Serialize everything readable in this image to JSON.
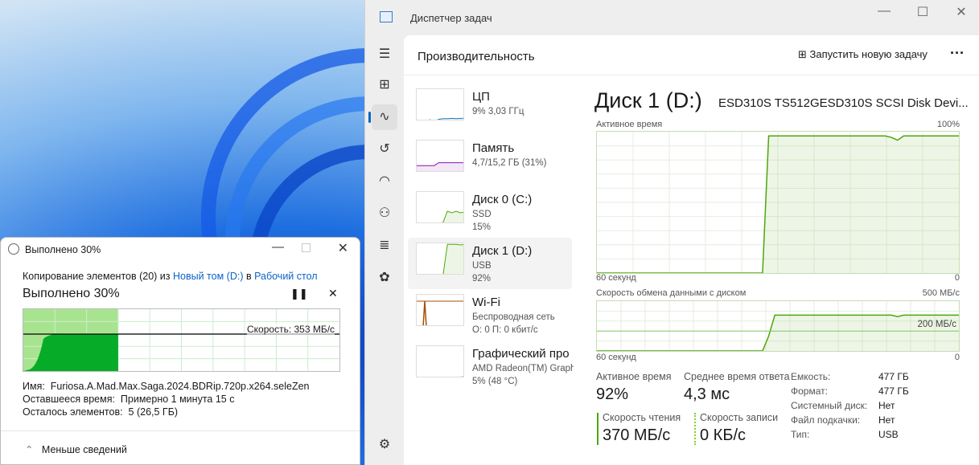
{
  "taskmanager": {
    "title": "Диспетчер задач",
    "header": "Производительность",
    "run_task": "Запустить новую задачу",
    "more": "···",
    "nav_icons": [
      "menu-icon",
      "processes-icon",
      "performance-icon",
      "app-history-icon",
      "startup-icon",
      "users-icon",
      "details-icon",
      "services-icon",
      "settings-icon"
    ],
    "devices": [
      {
        "name": "ЦП",
        "line1": "9% 3,03 ГГц",
        "line2": "",
        "color": "#1f7ac4"
      },
      {
        "name": "Память",
        "line1": "4,7/15,2 ГБ (31%)",
        "line2": "",
        "color": "#8b12ae"
      },
      {
        "name": "Диск 0 (C:)",
        "line1": "SSD",
        "line2": "15%",
        "color": "#4da60c"
      },
      {
        "name": "Диск 1 (D:)",
        "line1": "USB",
        "line2": "92%",
        "color": "#4da60c",
        "selected": true
      },
      {
        "name": "Wi-Fi",
        "line1": "Беспроводная сеть",
        "line2": "О: 0 П: 0 кбит/с",
        "color": "#a74f01"
      },
      {
        "name": "Графический про",
        "line1": "AMD Radeon(TM) Graphics",
        "line2": "5% (48 °C)",
        "color": "#1f7ac4"
      }
    ],
    "detail": {
      "title": "Диск 1 (D:)",
      "model": "ESD310S TS512GESD310S SCSI Disk Devi...",
      "active_label": "Активное время",
      "active_max": "100%",
      "seconds": "60 секунд",
      "zero": "0",
      "transfer_label": "Скорость обмена данными с диском",
      "transfer_max": "500 МБ/с",
      "transfer_ref": "200 МБ/с",
      "active_history_percent": [
        0,
        0,
        0,
        0,
        0,
        0,
        0,
        0,
        0,
        0,
        0,
        0,
        0,
        0,
        0,
        0,
        0,
        0,
        0,
        0,
        0,
        0,
        0,
        0,
        0,
        0,
        0,
        0,
        97,
        97,
        97,
        97,
        97,
        97,
        97,
        97,
        97,
        97,
        97,
        97,
        97,
        97,
        97,
        97,
        97,
        97,
        97,
        97,
        96,
        94,
        97,
        97,
        97,
        97,
        97,
        97,
        97,
        97,
        97,
        97
      ],
      "transfer_history_mbs": [
        0,
        0,
        0,
        0,
        0,
        0,
        0,
        0,
        0,
        0,
        0,
        0,
        0,
        0,
        0,
        0,
        0,
        0,
        0,
        0,
        0,
        0,
        0,
        0,
        0,
        0,
        0,
        0,
        150,
        360,
        360,
        360,
        360,
        360,
        360,
        360,
        360,
        360,
        360,
        360,
        360,
        360,
        360,
        360,
        360,
        360,
        360,
        360,
        360,
        345,
        360,
        360,
        360,
        360,
        360,
        360,
        360,
        360,
        360,
        360
      ],
      "stats": {
        "active_time": {
          "label": "Активное время",
          "value": "92%"
        },
        "response": {
          "label": "Среднее время ответа",
          "value": "4,3 мс"
        },
        "read": {
          "label": "Скорость чтения",
          "value": "370 МБ/с"
        },
        "write": {
          "label": "Скорость записи",
          "value": "0 КБ/с"
        }
      },
      "props": [
        {
          "k": "Емкость:",
          "v": "477 ГБ"
        },
        {
          "k": "Формат:",
          "v": "477 ГБ"
        },
        {
          "k": "Системный диск:",
          "v": "Нет"
        },
        {
          "k": "Файл подкачки:",
          "v": "Нет"
        },
        {
          "k": "Тип:",
          "v": "USB"
        }
      ]
    }
  },
  "copy_dialog": {
    "title": "Выполнено 30%",
    "line_prefix": "Копирование элементов (20) из ",
    "source": "Новый том (D:)",
    "line_mid": " в ",
    "dest": "Рабочий стол",
    "progress_text": "Выполнено 30%",
    "progress_percent": 30,
    "speed": "Скорость: 353 МБ/с",
    "name_label": "Имя:",
    "name": "Furiosa.A.Mad.Max.Saga.2024.BDRip.720p.x264.seleZen",
    "time_label": "Оставшееся время:",
    "time": "Примерно 1 минута 15 с",
    "items_label": "Осталось элементов:",
    "items": "5 (26,5 ГБ)",
    "less": "Меньше сведений"
  }
}
